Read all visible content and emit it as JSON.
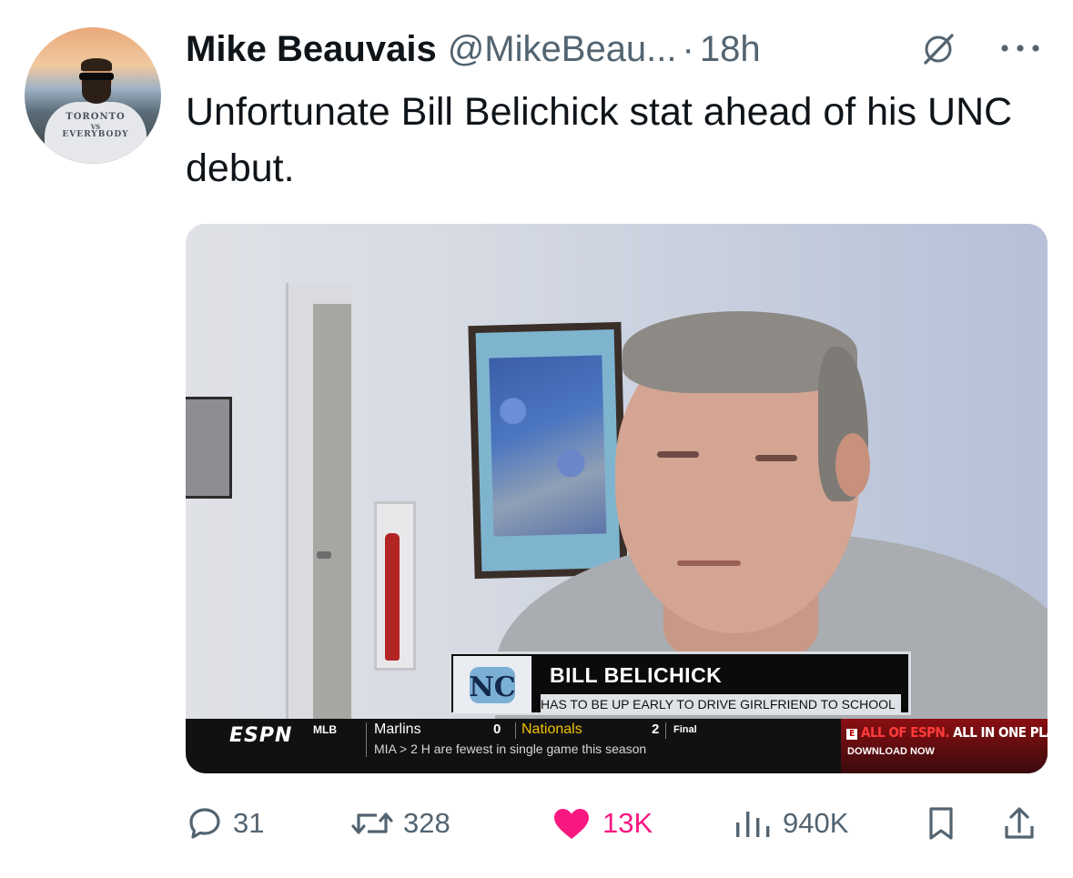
{
  "tweet": {
    "author_name": "Mike Beauvais",
    "handle": "@MikeBeau...",
    "separator": "·",
    "time": "18h",
    "text": "Unfortunate Bill Belichick stat ahead of his UNC debut.",
    "avatar_shirt": [
      "TORONTO",
      "VS",
      "EVERYBODY"
    ]
  },
  "media": {
    "lower_third": {
      "name": "BILL BELICHICK",
      "subtitle": "HAS TO BE UP EARLY TO DRIVE GIRLFRIEND TO SCHOOL"
    },
    "ticker": {
      "network": "ESPN",
      "league": "MLB",
      "team1": "Marlins",
      "score1": "0",
      "team2": "Nationals",
      "score2": "2",
      "status": "Final",
      "stat": "MIA  >  2 H are fewest in single game this season",
      "ad_line1_red": "ALL OF ESPN.",
      "ad_line1_white": " ALL IN ONE PLA",
      "ad_line2": "DOWNLOAD NOW"
    }
  },
  "actions": {
    "replies": "31",
    "reposts": "328",
    "likes": "13K",
    "views": "940K"
  },
  "colors": {
    "text": "#0f1419",
    "secondary": "#536471",
    "like": "#f91880"
  },
  "icons": [
    "grok-icon",
    "more-icon",
    "reply-icon",
    "repost-icon",
    "like-icon",
    "views-icon",
    "bookmark-icon",
    "share-icon"
  ]
}
